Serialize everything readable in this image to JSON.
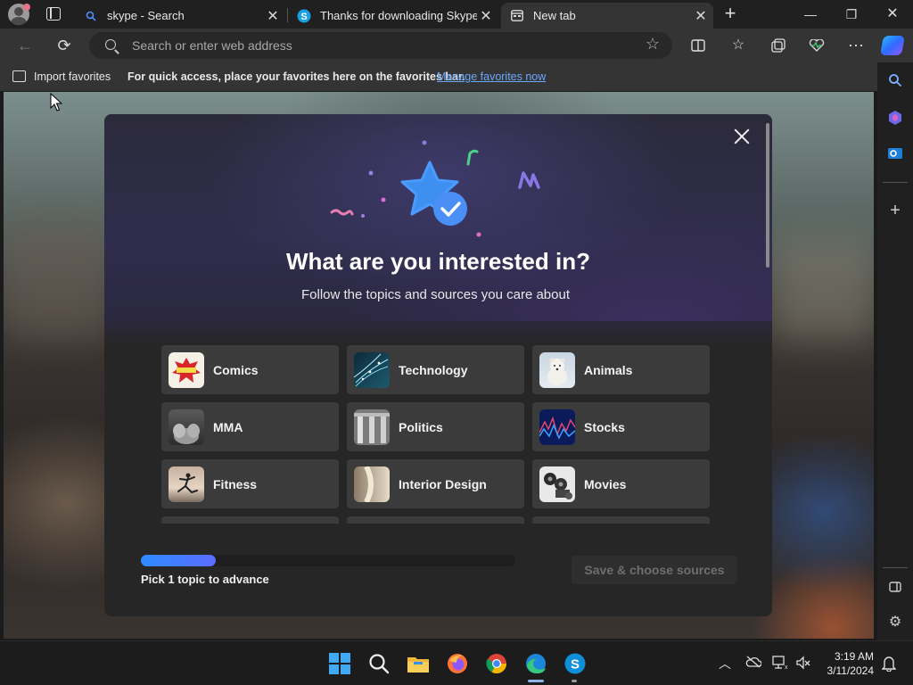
{
  "browser": {
    "tabs": [
      {
        "title": "skype - Search",
        "icon": "search-icon"
      },
      {
        "title": "Thanks for downloading Skype",
        "icon": "skype-icon"
      },
      {
        "title": "New tab",
        "icon": "newtab-icon",
        "active": true
      }
    ],
    "address_placeholder": "Search or enter web address"
  },
  "favorites_bar": {
    "import_label": "Import favorites",
    "hint": "For quick access, place your favorites here on the favorites bar.",
    "manage_link": "Manage favorites now"
  },
  "modal": {
    "title": "What are you interested in?",
    "subtitle": "Follow the topics and sources you care about",
    "topics": [
      {
        "label": "Comics"
      },
      {
        "label": "Technology"
      },
      {
        "label": "Animals"
      },
      {
        "label": "MMA"
      },
      {
        "label": "Politics"
      },
      {
        "label": "Stocks"
      },
      {
        "label": "Fitness"
      },
      {
        "label": "Interior Design"
      },
      {
        "label": "Movies"
      }
    ],
    "progress_fraction": 0.2,
    "progress_label": "Pick 1 topic to advance",
    "save_label": "Save & choose sources"
  },
  "taskbar": {
    "time": "3:19 AM",
    "date": "3/11/2024"
  },
  "colors": {
    "accent": "#2f8bff",
    "link": "#6aa8ff"
  }
}
